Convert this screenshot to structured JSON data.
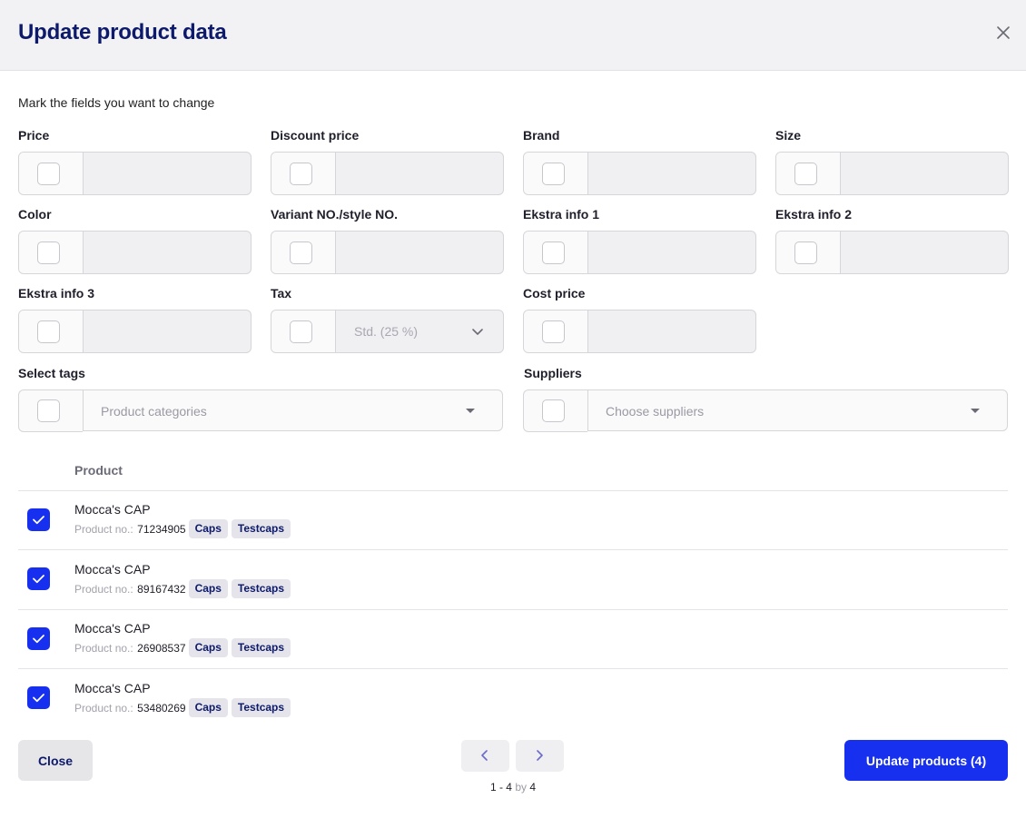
{
  "dialog": {
    "title": "Update product data",
    "instructions": "Mark the fields you want to change"
  },
  "fields": {
    "price": {
      "label": "Price"
    },
    "discount_price": {
      "label": "Discount price"
    },
    "brand": {
      "label": "Brand"
    },
    "size": {
      "label": "Size"
    },
    "color": {
      "label": "Color"
    },
    "variant_no": {
      "label": "Variant NO./style NO."
    },
    "ekstra_info_1": {
      "label": "Ekstra info 1"
    },
    "ekstra_info_2": {
      "label": "Ekstra info 2"
    },
    "ekstra_info_3": {
      "label": "Ekstra info 3"
    },
    "tax": {
      "label": "Tax",
      "selected": "Std. (25 %)"
    },
    "cost_price": {
      "label": "Cost price"
    },
    "tags": {
      "label": "Select tags",
      "placeholder": "Product categories"
    },
    "suppliers": {
      "label": "Suppliers",
      "placeholder": "Choose suppliers"
    }
  },
  "table": {
    "column_header": "Product",
    "product_no_label": "Product no.:",
    "rows": [
      {
        "name": "Mocca's CAP",
        "product_no": "71234905",
        "tags": [
          "Caps",
          "Testcaps"
        ],
        "checked": true
      },
      {
        "name": "Mocca's CAP",
        "product_no": "89167432",
        "tags": [
          "Caps",
          "Testcaps"
        ],
        "checked": true
      },
      {
        "name": "Mocca's CAP",
        "product_no": "26908537",
        "tags": [
          "Caps",
          "Testcaps"
        ],
        "checked": true
      },
      {
        "name": "Mocca's CAP",
        "product_no": "53480269",
        "tags": [
          "Caps",
          "Testcaps"
        ],
        "checked": true
      }
    ]
  },
  "footer": {
    "close_label": "Close",
    "update_label": "Update products (4)",
    "pagination": {
      "range": "1 - 4",
      "by_word": "by",
      "total": "4"
    }
  },
  "colors": {
    "accent": "#1730ef",
    "title": "#0d1a6b",
    "header_bg": "#f2f2f4"
  }
}
